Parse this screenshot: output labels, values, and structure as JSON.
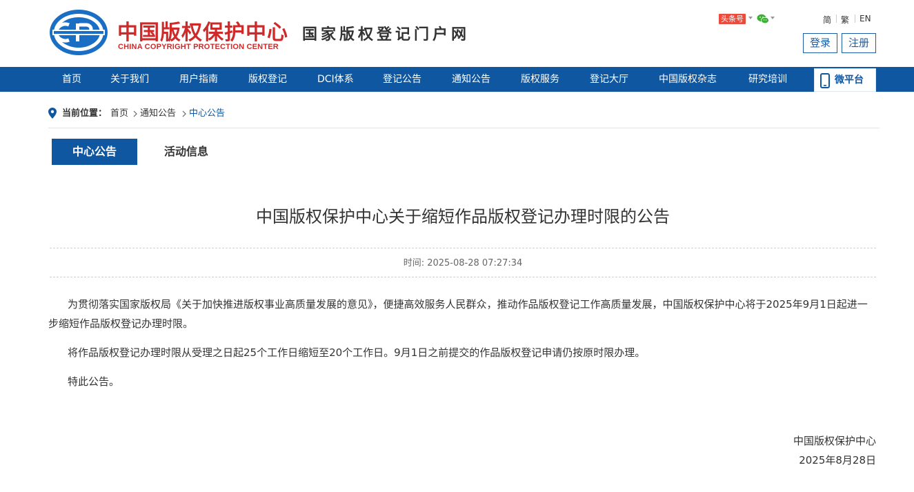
{
  "header": {
    "org_name_cn": "中国版权保护中心",
    "org_name_en": "CHINA COPYRIGHT PROTECTION CENTER",
    "portal_name": "国家版权登记门户网",
    "toutiao_label": "头条号",
    "lang_simplified": "简",
    "lang_traditional": "繁",
    "lang_english": "EN",
    "login_label": "登录",
    "register_label": "注册"
  },
  "nav": {
    "items": [
      "首页",
      "关于我们",
      "用户指南",
      "版权登记",
      "DCI体系",
      "登记公告",
      "通知公告",
      "版权服务",
      "登记大厅",
      "中国版权杂志",
      "研究培训"
    ],
    "wei_label": "微平台"
  },
  "breadcrumb": {
    "prefix": "当前位置：",
    "items": [
      "首页",
      "通知公告",
      "中心公告"
    ]
  },
  "tabs": {
    "active": "中心公告",
    "inactive": "活动信息"
  },
  "article": {
    "title": "中国版权保护中心关于缩短作品版权登记办理时限的公告",
    "time": "时间: 2025-08-28 07:27:34",
    "paragraphs": [
      "为贯彻落实国家版权局《关于加快推进版权事业高质量发展的意见》，便捷高效服务人民群众，推动作品版权登记工作高质量发展，中国版权保护中心将于2025年9月1日起进一步缩短作品版权登记办理时限。",
      "将作品版权登记办理时限从受理之日起25个工作日缩短至20个工作日。9月1日之前提交的作品版权登记申请仍按原时限办理。",
      "特此公告。"
    ],
    "sign_org": "中国版权保护中心",
    "sign_date": "2025年8月28日"
  },
  "colors": {
    "brand_blue": "#0f57a1",
    "brand_red": "#cf2a2a"
  }
}
